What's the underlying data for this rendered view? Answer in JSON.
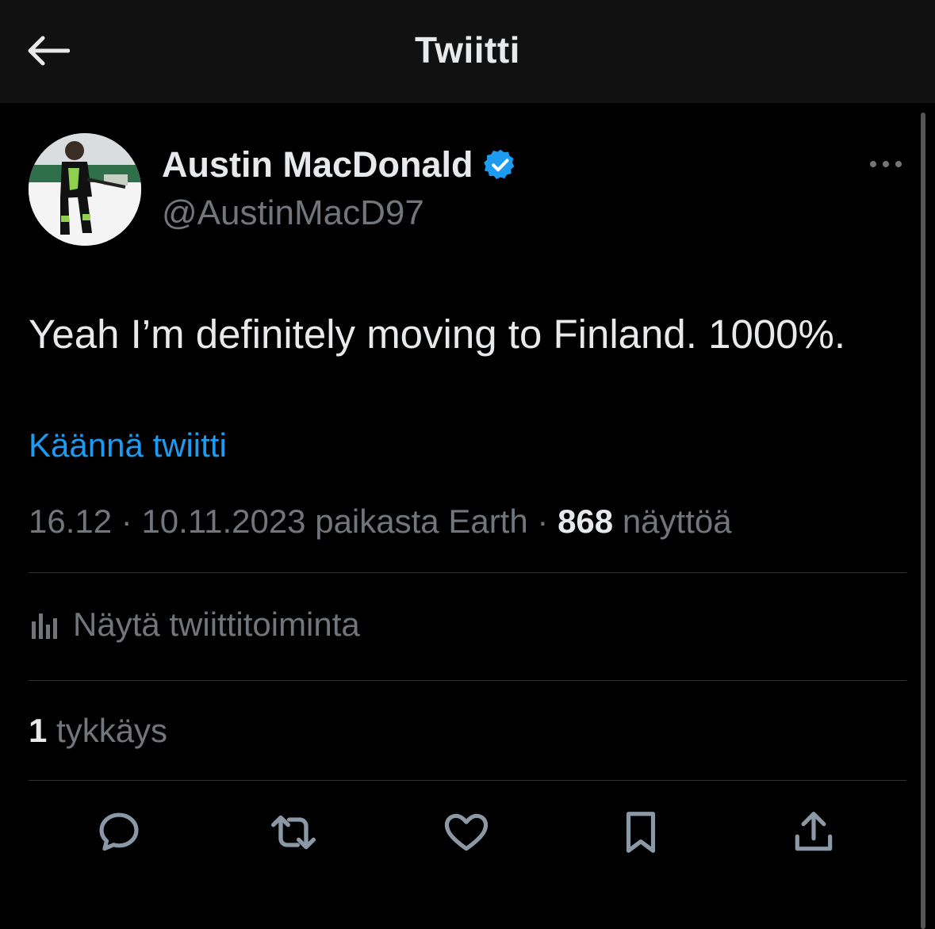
{
  "header": {
    "title": "Twiitti"
  },
  "author": {
    "display_name": "Austin MacDonald",
    "handle": "@AustinMacD97",
    "verified": true
  },
  "tweet": {
    "text": "Yeah I’m definitely moving to Finland. 1000%.",
    "translate_label": "Käännä twiitti",
    "time": "16.12",
    "date": "10.11.2023",
    "source": "paikasta Earth",
    "separator": "·",
    "views_count": "868",
    "views_label": "näyttöä"
  },
  "analytics": {
    "label": "Näytä twiittitoiminta"
  },
  "likes": {
    "count": "1",
    "label": "tykkäys"
  },
  "actions": [
    {
      "name": "reply",
      "icon": "speech-bubble-icon"
    },
    {
      "name": "retweet",
      "icon": "retweet-icon"
    },
    {
      "name": "like",
      "icon": "heart-icon"
    },
    {
      "name": "bookmark",
      "icon": "bookmark-icon"
    },
    {
      "name": "share",
      "icon": "share-icon"
    }
  ],
  "colors": {
    "background": "#000000",
    "header_background": "#111111",
    "text": "#e7e9ea",
    "secondary_text": "#71767b",
    "accent": "#1d9bf0",
    "divider": "#2f3336"
  }
}
